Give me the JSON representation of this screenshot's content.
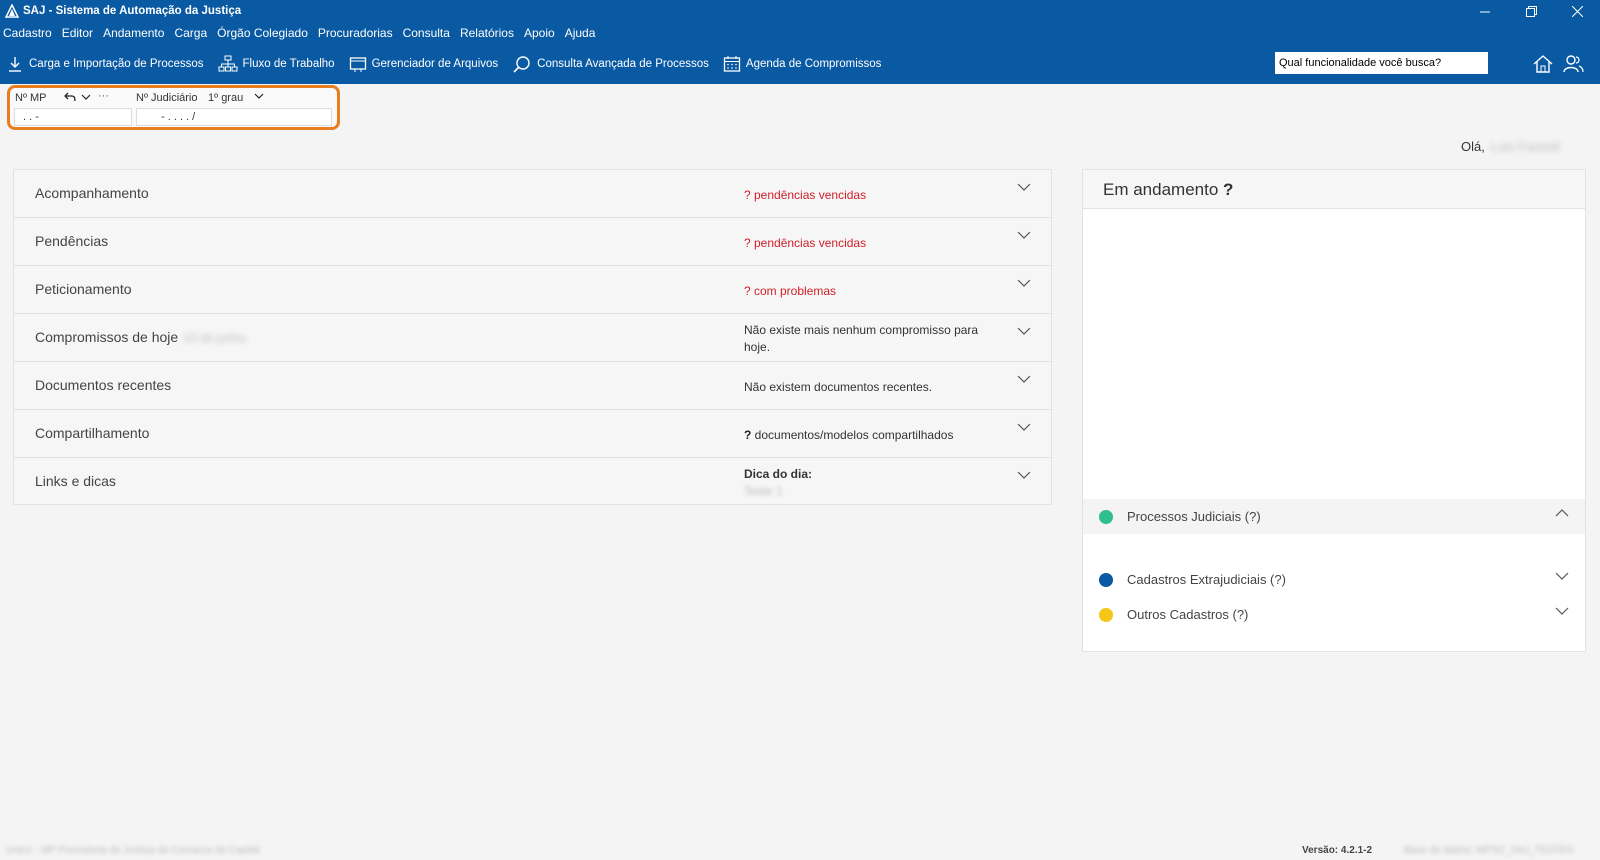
{
  "titlebar": {
    "title": "SAJ - Sistema de Automação da Justiça"
  },
  "menu": [
    "Cadastro",
    "Editor",
    "Andamento",
    "Carga",
    "Órgão Colegiado",
    "Procuradorias",
    "Consulta",
    "Relatórios",
    "Apoio",
    "Ajuda"
  ],
  "toolbar": {
    "carga": "Carga e Importação de Processos",
    "fluxo": "Fluxo de Trabalho",
    "gerenciador": "Gerenciador de Arquivos",
    "consulta": "Consulta Avançada de Processos",
    "agenda": "Agenda de Compromissos",
    "search_value": "Qual funcionalidade você busca?"
  },
  "quick": {
    "mp_label": "Nº MP",
    "more": "···",
    "jud_label": "Nº Judiciário",
    "grau": "1º grau",
    "mp_mask": ". .       -",
    "jud_mask": "- .   . . .  /"
  },
  "greeting": {
    "prefix": "Olá,",
    "name": "Luiz Fazzeli"
  },
  "accordion": [
    {
      "label": "Acompanhamento",
      "info": "? pendências vencidas"
    },
    {
      "label": "Pendências",
      "info": "? pendências vencidas"
    },
    {
      "label": "Peticionamento",
      "info": "? com problemas"
    },
    {
      "label": "Compromissos de hoje",
      "date": "10 de junho",
      "info": "Não existe mais nenhum compromisso para hoje."
    },
    {
      "label": "Documentos recentes",
      "info": "Não existem documentos recentes."
    },
    {
      "label": "Compartilhamento",
      "q": "?",
      "info": " documentos/modelos compartilhados"
    },
    {
      "label": "Links e dicas",
      "info_title": "Dica do dia:",
      "info": "Teste 1"
    }
  ],
  "panel": {
    "title": "Em andamento",
    "q": "?",
    "categories": [
      {
        "name": "Processos Judiciais (?)",
        "color": "#2fbf8f"
      },
      {
        "name": "Cadastros Extrajudiciais (?)",
        "color": "#0a5aa3"
      },
      {
        "name": "Outros Cadastros (?)",
        "color": "#f5c518"
      }
    ]
  },
  "status": {
    "left": "Unico - 38ª Promotoria de Justiça da Comarca da Capital",
    "version": "Versão: 4.2.1-2",
    "db": "Base de dados: MPSC_SAJ_TESTES"
  }
}
